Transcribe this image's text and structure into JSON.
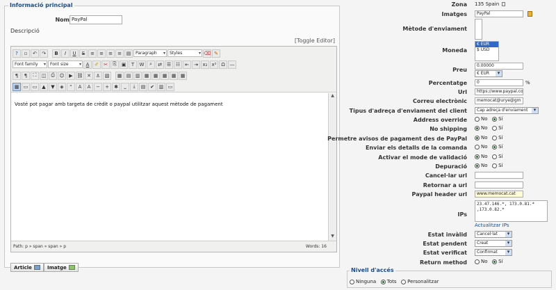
{
  "main": {
    "legend": "Informació principal",
    "nom_label": "Nom",
    "nom_value": "PayPal",
    "descripcio_label": "Descripció",
    "toggle_editor": "[Toggle Editor]",
    "editor": {
      "format_select": "Paragraph",
      "styles_select": "Styles",
      "font_family": "Font family",
      "font_size": "Font size",
      "content": "Vosté pot pagar amb targeta de crèdit o paypal utilitzar aquest mètode de pagament",
      "path": "Path: p » span » span » p",
      "words": "Words: 16"
    },
    "btn_article": "Article",
    "btn_imatge": "Imatge"
  },
  "right": {
    "zona_label": "Zona",
    "zona_value": "135 Spain",
    "imatges_label": "Imatges",
    "imatges_value": "PayPal",
    "metode_label": "Mètode d'enviament",
    "moneda_label": "Moneda",
    "moneda_options": [
      "€ EUR",
      "$ USD"
    ],
    "preu_label": "Preu",
    "preu_value": "0.00000",
    "preu_currency": "€ EUR",
    "percentatge_label": "Percentatge",
    "percentatge_value": "0",
    "percentatge_unit": "%",
    "url_label": "Url",
    "url_value": "https://www.paypal.com",
    "correu_label": "Correu electrònic",
    "correu_value": "memocat@urye@gm",
    "tipus_label": "Tipus d'adreça d'enviament del client",
    "tipus_value": "Cap adreça d'enviament",
    "address_override_label": "Address override",
    "no_shipping_label": "No shipping",
    "permetre_label": "Permetre avisos de pagament des de PayPal",
    "enviar_label": "Enviar els detalls de la comanda",
    "activar_label": "Activar el mode de validació",
    "depuracio_label": "Depuració",
    "cancel_label": "Cancel·lar url",
    "retornar_label": "Retornar a url",
    "header_label": "Paypal header url",
    "header_value": "www.memocat.cat",
    "ips_label": "IPs",
    "ips_value": "23.47.146.*, 173.0.81.* ,173.0.82.*",
    "actualitzar_ips": "Actualitzar IPs",
    "estat_invalid_label": "Estat invàlid",
    "estat_invalid_value": "Cancel·lat",
    "estat_pendent_label": "Estat pendent",
    "estat_pendent_value": "Creat",
    "estat_verificat_label": "Estat verificat",
    "estat_verificat_value": "Confirmat",
    "return_method_label": "Return method",
    "radio_no": "No",
    "radio_si": "Sí"
  },
  "access": {
    "legend": "Nivell d'accés",
    "opt_ninguna": "Ninguna",
    "opt_tots": "Tots",
    "opt_personalitzar": "Personalitzar"
  },
  "colors": {
    "accent": "#1a4d88",
    "selected": "#316ac5",
    "highlight": "#fffbd6"
  }
}
